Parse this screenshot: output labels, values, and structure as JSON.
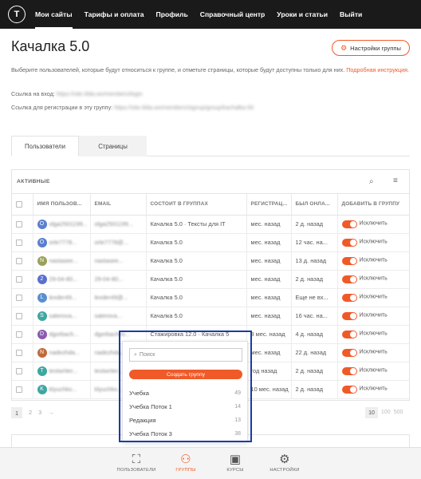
{
  "nav": {
    "logo": "T",
    "items": [
      "Мои сайты",
      "Тарифы и оплата",
      "Профиль",
      "Справочный центр",
      "Уроки и статьи",
      "Выйти"
    ]
  },
  "header": {
    "title": "Качалка 5.0",
    "settings_button": "Настройки группы"
  },
  "description": {
    "text": "Выберите пользователей, которые будут относиться к группе, и отметьте страницы, которые будут доступны только для них.",
    "link": "Подробная инструкция."
  },
  "links": {
    "login_label": "Ссылка на вход:",
    "login_url": "https://site.tilda.ws/members/login",
    "reg_label": "Ссылка для регистрации в эту группу:",
    "reg_url": "https://site.tilda.ws/members/signup/group/kachalka-50"
  },
  "tabs": [
    "Пользователи",
    "Страницы"
  ],
  "table": {
    "section_label": "АКТИВНЫЕ",
    "columns": [
      "ИМЯ ПОЛЬЗОВ...",
      "EMAIL",
      "СОСТОИТ В ГРУППАХ",
      "РЕГИСТРАЦ...",
      "БЫЛ ОНЛА...",
      "ДОБАВИТЬ В ГРУППУ"
    ],
    "toggle_label": "Исключить",
    "rows": [
      {
        "initial": "O",
        "color": "#5a7fcf",
        "name": "olga2501199...",
        "email": "olga2501199...",
        "groups": "Качалка 5.0 · Тексты для IT",
        "reg": "мес. назад",
        "online": "2 д. назад"
      },
      {
        "initial": "O",
        "color": "#5a7fcf",
        "name": "orle7778...",
        "email": "orle7778@...",
        "groups": "Качалка 5.0",
        "reg": "мес. назад",
        "online": "12 час. на..."
      },
      {
        "initial": "N",
        "color": "#9aa05a",
        "name": "nastasee...",
        "email": "nastasee...",
        "groups": "Качалка 5.0",
        "reg": "мес. назад",
        "online": "13 д. назад"
      },
      {
        "initial": "2",
        "color": "#5a6fcf",
        "name": "29-04-80...",
        "email": "29-04-80...",
        "groups": "Качалка 5.0",
        "reg": "мес. назад",
        "online": "2 д. назад"
      },
      {
        "initial": "L",
        "color": "#5a8fcf",
        "name": "lexder49...",
        "email": "lexder49@...",
        "groups": "Качалка 5.0",
        "reg": "мес. назад",
        "online": "Еще не вх..."
      },
      {
        "initial": "S",
        "color": "#3fa6a0",
        "name": "saterova...",
        "email": "saterova...",
        "groups": "Качалка 5.0",
        "reg": "мес. назад",
        "online": "16 час. на..."
      },
      {
        "initial": "D",
        "color": "#8a5ab0",
        "name": "dgorbach...",
        "email": "dgorbachev...",
        "groups": "Стажировка 12.0 · Качалка 5",
        "reg": "8 мес. назад",
        "online": "4 д. назад"
      },
      {
        "initial": "N",
        "color": "#c06a3a",
        "name": "nadezhda...",
        "email": "nadezhda...",
        "groups": "",
        "reg": "мес. назад",
        "online": "22 д. назад"
      },
      {
        "initial": "T",
        "color": "#3fa6a0",
        "name": "testwriter...",
        "email": "testwriter...",
        "groups": "",
        "reg": "год назад",
        "online": "2 д. назад"
      },
      {
        "initial": "K",
        "color": "#3fa6a0",
        "name": "klyuchko...",
        "email": "klyuchko...",
        "groups": "",
        "reg": "10 мес. назад",
        "online": "2 д. назад"
      }
    ]
  },
  "pagination": {
    "pages": [
      "1",
      "2",
      "3",
      "→"
    ],
    "per_page": [
      "10",
      "100",
      "500"
    ]
  },
  "dropdown": {
    "search_placeholder": "Поиск",
    "create_button": "Создать группу",
    "items": [
      {
        "name": "Учебка",
        "count": "49"
      },
      {
        "name": "Учебка Поток 1",
        "count": "14"
      },
      {
        "name": "Редакция",
        "count": "13"
      },
      {
        "name": "Учебка Поток 3",
        "count": "38"
      }
    ]
  },
  "bottom_nav": [
    {
      "label": "ПОЛЬЗОВАТЕЛИ",
      "icon": "users-frame-icon"
    },
    {
      "label": "ГРУППЫ",
      "icon": "group-icon"
    },
    {
      "label": "КУРСЫ",
      "icon": "video-icon"
    },
    {
      "label": "НАСТРОЙКИ",
      "icon": "gear-icon"
    }
  ],
  "colors": {
    "accent": "#f05a28",
    "nav_bg": "#1a1a1a",
    "highlight": "#1a3ca8"
  }
}
